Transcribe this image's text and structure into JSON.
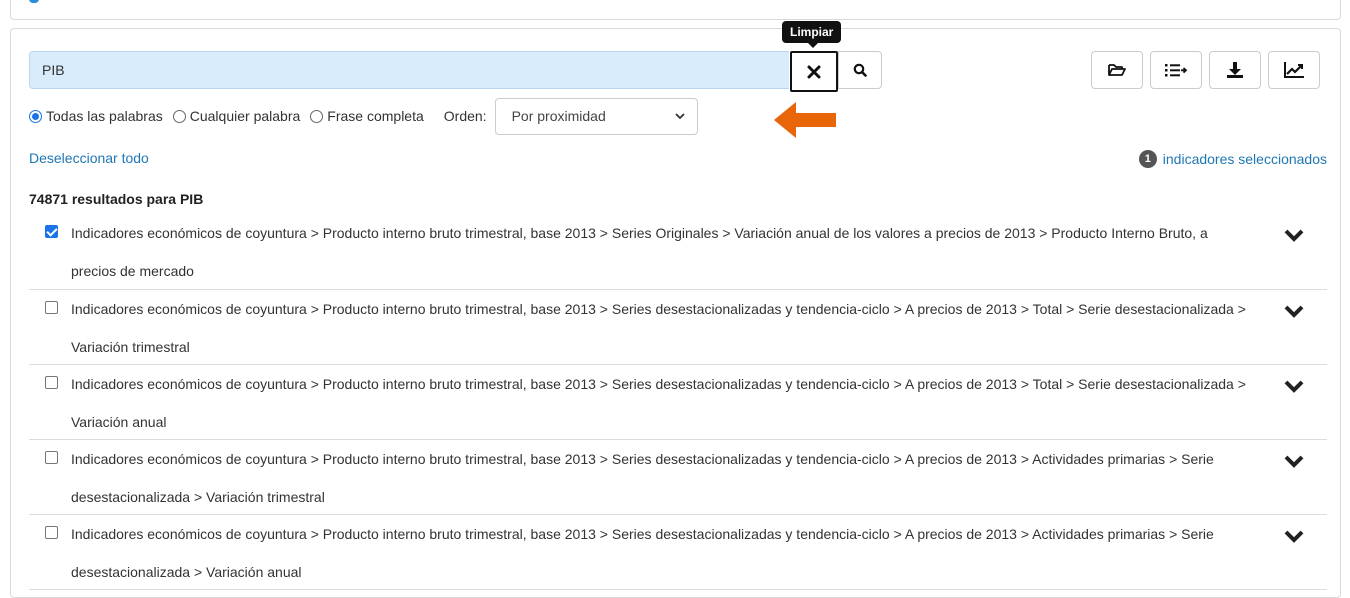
{
  "search": {
    "value": "PIB",
    "tooltip": "Limpiar"
  },
  "options": {
    "radios": [
      {
        "label": "Todas las palabras",
        "checked": true
      },
      {
        "label": "Cualquier palabra",
        "checked": false
      },
      {
        "label": "Frase completa",
        "checked": false
      }
    ],
    "order_label": "Orden:",
    "order_value": "Por proximidad"
  },
  "actions": {
    "deselect_all": "Deseleccionar todo",
    "selected_count": "1",
    "selected_label": "indicadores seleccionados"
  },
  "results": {
    "summary": "74871 resultados para PIB",
    "items": [
      {
        "checked": true,
        "text": "Indicadores económicos de coyuntura > Producto interno bruto trimestral, base 2013 > Series Originales > Variación anual de los valores a precios de 2013 > Producto Interno Bruto, a precios de mercado"
      },
      {
        "checked": false,
        "text": "Indicadores económicos de coyuntura > Producto interno bruto trimestral, base 2013 > Series desestacionalizadas y tendencia-ciclo > A precios de 2013 > Total > Serie desestacionalizada > Variación trimestral"
      },
      {
        "checked": false,
        "text": "Indicadores económicos de coyuntura > Producto interno bruto trimestral, base 2013 > Series desestacionalizadas y tendencia-ciclo > A precios de 2013 > Total > Serie desestacionalizada > Variación anual"
      },
      {
        "checked": false,
        "text": "Indicadores económicos de coyuntura > Producto interno bruto trimestral, base 2013 > Series desestacionalizadas y tendencia-ciclo > A precios de 2013 > Actividades primarias > Serie desestacionalizada > Variación trimestral"
      },
      {
        "checked": false,
        "text": "Indicadores económicos de coyuntura > Producto interno bruto trimestral, base 2013 > Series desestacionalizadas y tendencia-ciclo > A precios de 2013 > Actividades primarias > Serie desestacionalizada > Variación anual"
      }
    ]
  },
  "colors": {
    "accent": "#1a73e8",
    "link": "#1f77b4",
    "annotation_arrow": "#e8650a",
    "search_bg": "#d9ecfb"
  },
  "icons": [
    "close-icon",
    "search-icon",
    "folder-open-icon",
    "list-arrow-icon",
    "download-icon",
    "line-chart-icon",
    "chevron-down-icon"
  ]
}
